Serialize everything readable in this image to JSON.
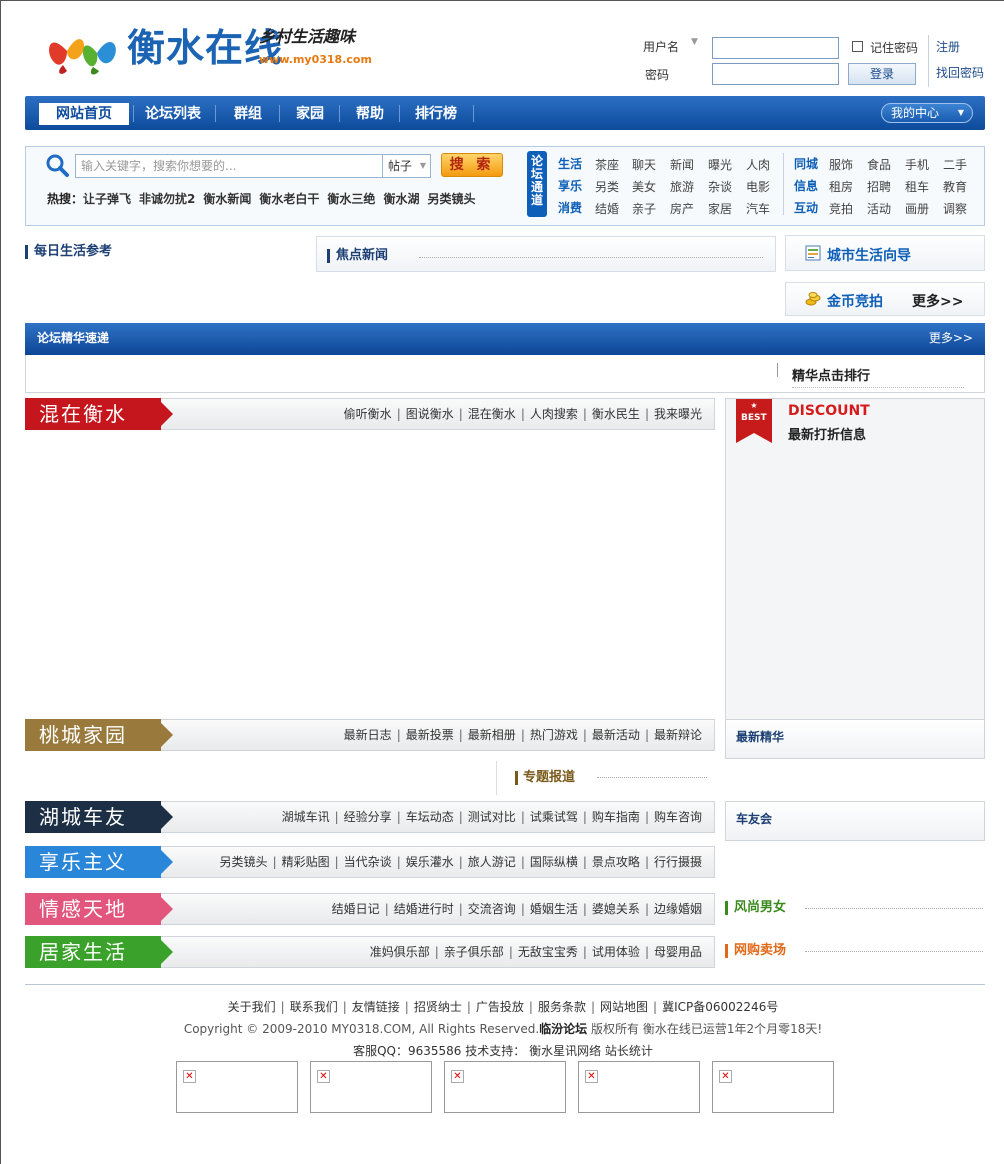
{
  "header": {
    "site_name": "衡水在线",
    "slogan": "乡村生活趣味",
    "url": "www.my0318.com",
    "login": {
      "username_label": "用户名",
      "password_label": "密码",
      "remember_label": "记住密码",
      "login_button": "登录",
      "register_link": "注册",
      "forgot_link": "找回密码"
    }
  },
  "nav": {
    "items": [
      "网站首页",
      "论坛列表",
      "群组",
      "家园",
      "帮助",
      "排行榜"
    ],
    "my_center": "我的中心"
  },
  "search": {
    "placeholder": "输入关键字，搜索你想要的...",
    "select_value": "帖子",
    "button": "搜 索",
    "hot_label": "热搜：",
    "hot_terms": [
      "让子弹飞",
      "非诚勿扰2",
      "衡水新闻",
      "衡水老白干",
      "衡水三绝",
      "衡水湖",
      "另类镜头"
    ]
  },
  "channels": {
    "badge": "论坛通道",
    "groups": [
      {
        "cat": "生活",
        "links": [
          "茶座",
          "聊天",
          "新闻",
          "曝光",
          "人肉"
        ]
      },
      {
        "cat": "享乐",
        "links": [
          "另类",
          "美女",
          "旅游",
          "杂谈",
          "电影"
        ]
      },
      {
        "cat": "消费",
        "links": [
          "结婚",
          "亲子",
          "房产",
          "家居",
          "汽车"
        ]
      }
    ],
    "groups2": [
      {
        "cat": "同城",
        "links": [
          "服饰",
          "食品",
          "手机",
          "二手"
        ]
      },
      {
        "cat": "信息",
        "links": [
          "租房",
          "招聘",
          "租车",
          "教育"
        ]
      },
      {
        "cat": "互动",
        "links": [
          "竞拍",
          "活动",
          "画册",
          "调察"
        ]
      }
    ]
  },
  "sections": {
    "daily": "每日生活参考",
    "focus_news": "焦点新闻",
    "city_guide": "城市生活向导",
    "gold_bid": "金币竞拍",
    "more_bold": "更多>>",
    "forum_digest": "论坛精华速递",
    "more": "更多>>",
    "digest_rank": "精华点击排行",
    "discount_title": "DISCOUNT",
    "discount_sub": "最新打折信息",
    "best_badge": "BEST",
    "latest_digest": "最新精华",
    "special_report": "专题报道",
    "car_club": "车友会",
    "fashion": "风尚男女",
    "shopping": "网购卖场"
  },
  "banners": [
    {
      "tag": "混在衡水",
      "color": "#c5161d",
      "links": [
        "偷听衡水",
        "图说衡水",
        "混在衡水",
        "人肉搜索",
        "衡水民生",
        "我来曝光"
      ]
    },
    {
      "tag": "桃城家园",
      "color": "#9a7a3c",
      "links": [
        "最新日志",
        "最新投票",
        "最新相册",
        "热门游戏",
        "最新活动",
        "最新辩论"
      ]
    },
    {
      "tag": "湖城车友",
      "color": "#1d2f45",
      "links": [
        "湖城车讯",
        "经验分享",
        "车坛动态",
        "测试对比",
        "试乘试驾",
        "购车指南",
        "购车咨询"
      ]
    },
    {
      "tag": "享乐主义",
      "color": "#2a86d8",
      "links": [
        "另类镜头",
        "精彩贴图",
        "当代杂谈",
        "娱乐灌水",
        "旅人游记",
        "国际纵横",
        "景点攻略",
        "行行摄摄"
      ]
    },
    {
      "tag": "情感天地",
      "color": "#e2567e",
      "links": [
        "结婚日记",
        "结婚进行时",
        "交流咨询",
        "婚姻生活",
        "婆媳关系",
        "边缘婚姻"
      ]
    },
    {
      "tag": "居家生活",
      "color": "#3aa22a",
      "links": [
        "准妈俱乐部",
        "亲子俱乐部",
        "无敌宝宝秀",
        "试用体验",
        "母婴用品"
      ]
    }
  ],
  "footer": {
    "links": [
      "关于我们",
      "联系我们",
      "友情链接",
      "招贤纳士",
      "广告投放",
      "服务条款",
      "网站地图",
      "冀ICP备06002246号"
    ],
    "copyright_pre": "Copyright © 2009-2010 MY0318.COM, All Rights Reserved.",
    "copyright_bold": "临汾论坛",
    "copyright_post": " 版权所有  衡水在线已运营1年2个月零18天!",
    "service": "客服QQ：9635586 技术支持：  衡水星讯网络  站长统计"
  },
  "colors": {
    "primary": "#0d5fb8",
    "nav_dark": "#0d4b9c",
    "accent_orange": "#e8790f"
  }
}
